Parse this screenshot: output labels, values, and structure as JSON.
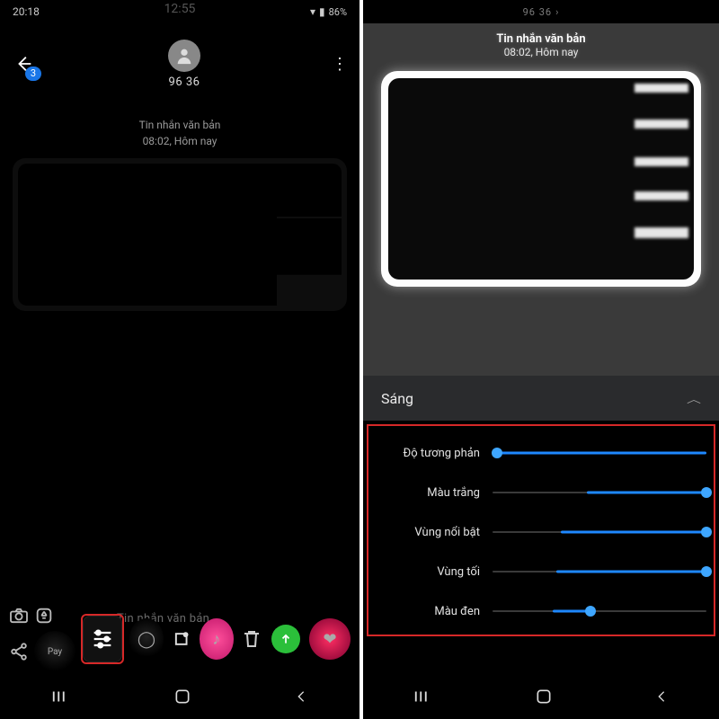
{
  "left": {
    "status": {
      "time": "20:18",
      "ghost_time": "12:55",
      "battery": "86%"
    },
    "back_badge": "3",
    "contact": "96 36",
    "msg_title": "Tin nhắn văn bản",
    "msg_time": "08:02, Hôm nay",
    "ghost_input": "Tin nhắn văn bản"
  },
  "right": {
    "top_contact": "96 36",
    "msg_title": "Tin nhắn văn bản",
    "msg_time": "08:02, Hôm nay",
    "section": "Sáng",
    "sliders": [
      {
        "label": "Độ tương phản",
        "thumb": 2,
        "fill_from": 2,
        "fill_to": 100
      },
      {
        "label": "Màu trắng",
        "thumb": 100,
        "fill_from": 44,
        "fill_to": 100
      },
      {
        "label": "Vùng nổi bật",
        "thumb": 100,
        "fill_from": 32,
        "fill_to": 100
      },
      {
        "label": "Vùng tối",
        "thumb": 100,
        "fill_from": 30,
        "fill_to": 100
      },
      {
        "label": "Màu đen",
        "thumb": 46,
        "fill_from": 28,
        "fill_to": 46
      }
    ]
  },
  "icons": {
    "back": "back-arrow",
    "kebab": "⋮",
    "recents": "recents",
    "home": "home",
    "navback": "nav-back"
  }
}
